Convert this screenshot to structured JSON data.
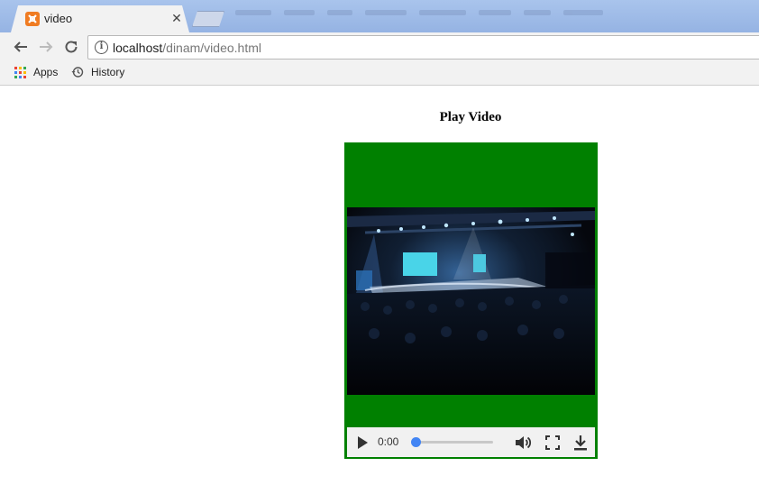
{
  "browser": {
    "tab": {
      "title": "video",
      "close_glyph": "✕",
      "favicon": "xampp-icon",
      "favicon_color": "#f07c22"
    },
    "address": {
      "host": "localhost",
      "path": "/dinam/video.html"
    },
    "bookmarks": [
      {
        "label": "Apps",
        "icon": "apps-grid-icon"
      },
      {
        "label": "History",
        "icon": "history-icon"
      }
    ]
  },
  "page": {
    "heading": "Play Video",
    "player": {
      "frame_color": "#008000",
      "current_time": "0:00",
      "progress": 0.04,
      "accent_color": "#4285f4"
    }
  }
}
